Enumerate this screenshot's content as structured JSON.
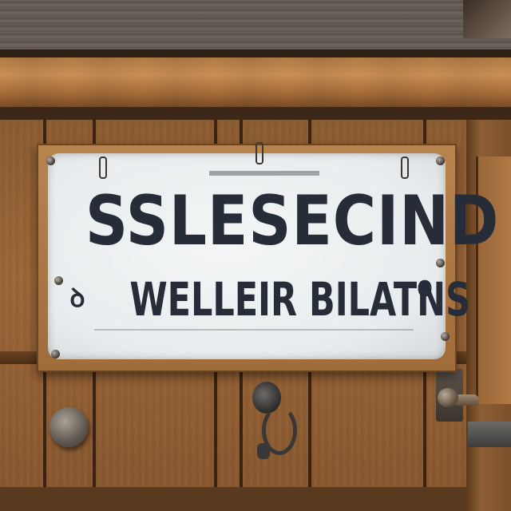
{
  "sign": {
    "line1": "SSLESECIND",
    "line2": "WELLEIR BILATNS",
    "left_mark": "ꝺ",
    "right_mark": "0"
  },
  "colors": {
    "sign_text": "#262d38",
    "sign_board": "#eef1f2",
    "wood": "#a06a3b"
  }
}
